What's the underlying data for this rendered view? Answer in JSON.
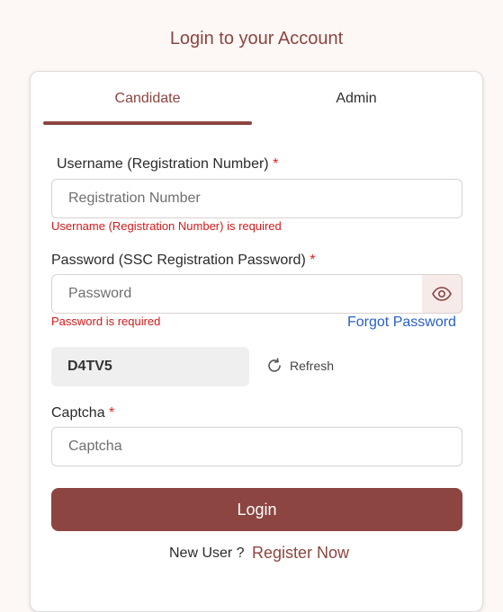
{
  "page": {
    "title": "Login to your Account"
  },
  "tabs": [
    {
      "label": "Candidate",
      "active": true
    },
    {
      "label": "Admin",
      "active": false
    }
  ],
  "form": {
    "username": {
      "label": "Username (Registration Number)",
      "required_mark": "*",
      "placeholder": "Registration Number",
      "value": "",
      "error": "Username (Registration Number) is required"
    },
    "password": {
      "label": "Password (SSC Registration Password)",
      "required_mark": "*",
      "placeholder": "Password",
      "value": "",
      "error": "Password is required",
      "toggle_icon": "eye-icon"
    },
    "forgot_password": "Forgot Password",
    "captcha_code": "D4TV5",
    "refresh": {
      "label": "Refresh",
      "icon": "refresh-icon"
    },
    "captcha": {
      "label": "Captcha",
      "required_mark": "*",
      "placeholder": "Captcha",
      "value": ""
    },
    "login_button": "Login",
    "new_user_text": "New User ?",
    "register_link": "Register Now"
  },
  "colors": {
    "brand": "#8c4540",
    "error": "#d11a1a",
    "link": "#2860c8",
    "background": "#fdf8f6"
  }
}
